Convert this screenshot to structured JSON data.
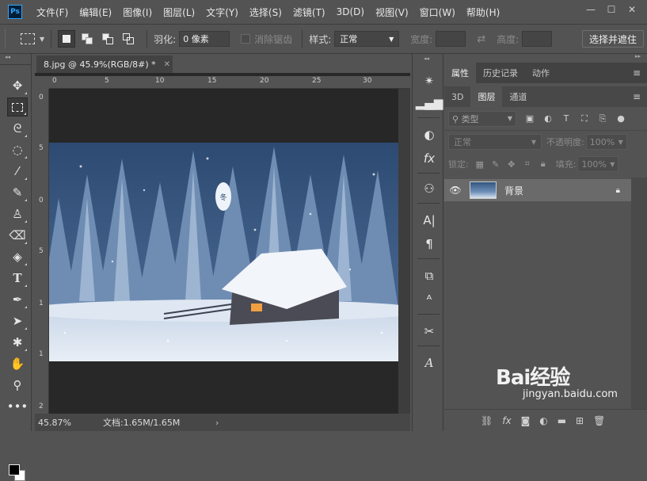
{
  "app": {
    "logo_text": "Ps"
  },
  "menu": [
    "文件(F)",
    "编辑(E)",
    "图像(I)",
    "图层(L)",
    "文字(Y)",
    "选择(S)",
    "滤镜(T)",
    "3D(D)",
    "视图(V)",
    "窗口(W)",
    "帮助(H)"
  ],
  "window_controls": {
    "minimize": "—",
    "restore": "☐",
    "close": "✕"
  },
  "options": {
    "feather_label": "羽化:",
    "feather_value": "0 像素",
    "antialias_label": "消除锯齿",
    "style_label": "样式:",
    "style_value": "正常",
    "width_label": "宽度:",
    "height_label": "高度:",
    "select_mask_button": "选择并遮住"
  },
  "document": {
    "tab_title": "8.jpg @ 45.9%(RGB/8#) *",
    "zoom": "45.87%",
    "doc_info": "文档:1.65M/1.65M",
    "ruler_top": [
      "0",
      "5",
      "10",
      "15",
      "20",
      "25",
      "30"
    ],
    "ruler_left": [
      "0",
      "5",
      "0",
      "5",
      "1",
      "1",
      "2"
    ]
  },
  "panels": {
    "top_tabs": [
      "属性",
      "历史记录",
      "动作"
    ],
    "sub_tabs": [
      "3D",
      "图层",
      "通道"
    ],
    "filter_placeholder": "类型",
    "blend_mode": "正常",
    "opacity_label": "不透明度:",
    "opacity_value": "100%",
    "lock_label": "锁定:",
    "fill_label": "填充:",
    "fill_value": "100%",
    "layers": [
      {
        "name": "背景",
        "visible": true,
        "locked": true
      }
    ]
  },
  "watermark": {
    "brand": "Bai经验",
    "url": "jingyan.baidu.com"
  },
  "colors": {
    "foreground": "#000000",
    "background": "#ffffff",
    "ui": "#535353"
  }
}
